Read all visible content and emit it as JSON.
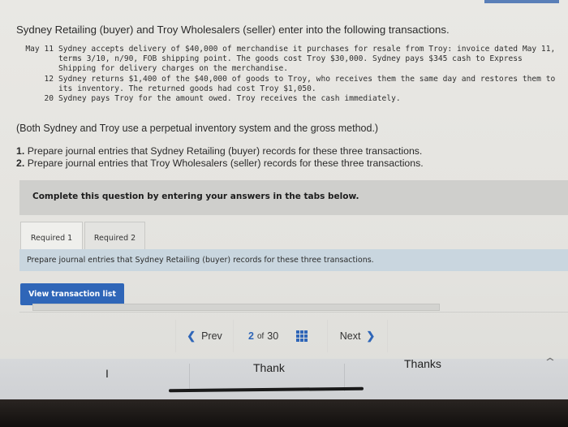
{
  "intro": "Sydney Retailing (buyer) and Troy Wholesalers (seller) enter into the following transactions.",
  "transactions": [
    {
      "date": "May 11",
      "text": "Sydney accepts delivery of $40,000 of merchandise it purchases for resale from Troy: invoice dated May 11, terms 3/10, n/90, FOB shipping point. The goods cost Troy $30,000. Sydney pays $345 cash to Express Shipping for delivery charges on the merchandise."
    },
    {
      "date": "12",
      "text": "Sydney returns $1,400 of the $40,000 of goods to Troy, who receives them the same day and restores them to its inventory. The returned goods had cost Troy $1,050."
    },
    {
      "date": "20",
      "text": "Sydney pays Troy for the amount owed. Troy receives the cash immediately."
    }
  ],
  "note": "(Both Sydney and Troy use a perpetual inventory system and the gross method.)",
  "requirements": [
    {
      "num": "1.",
      "text": "Prepare journal entries that Sydney Retailing (buyer) records for these three transactions."
    },
    {
      "num": "2.",
      "text": "Prepare journal entries that Troy Wholesalers (seller) records for these three transactions."
    }
  ],
  "banner": "Complete this question by entering your answers in the tabs below.",
  "tabs": [
    {
      "label": "Required 1",
      "active": true
    },
    {
      "label": "Required 2",
      "active": false
    }
  ],
  "instruction": "Prepare journal entries that Sydney Retailing (buyer) records for these three transactions.",
  "view_button": "View transaction list",
  "pager": {
    "prev": "Prev",
    "current": "2",
    "of": "of",
    "total": "30",
    "next": "Next",
    "prev_icon": "chevron-left",
    "next_icon": "chevron-right",
    "grid_icon": "grid"
  },
  "keyboard_suggestions": [
    "I",
    "Thank",
    "Thanks"
  ],
  "colors": {
    "accent": "#2f66b8",
    "banner": "#cfcfcc",
    "instruction_bg": "#c9d6df"
  }
}
